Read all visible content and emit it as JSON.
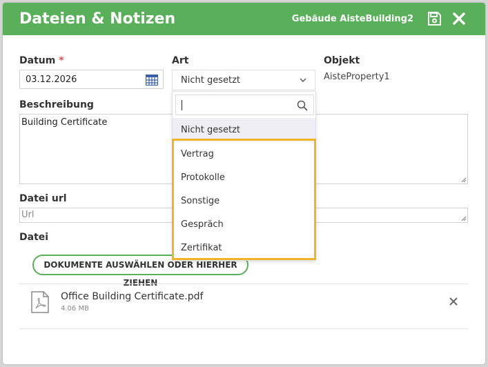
{
  "header": {
    "title": "Dateien & Notizen",
    "building": "Gebäude AisteBuilding2",
    "save_icon": "save-icon",
    "close_icon": "close-icon",
    "color": "#5aaf5a"
  },
  "form": {
    "datum": {
      "label": "Datum",
      "required_mark": "*",
      "value": "03.12.2026",
      "icon": "calendar-icon"
    },
    "art": {
      "label": "Art",
      "value": "Nicht gesetzt",
      "icon": "chevron-down-icon"
    },
    "objekt": {
      "label": "Objekt",
      "value": "AisteProperty1"
    },
    "beschreibung": {
      "label": "Beschreibung",
      "value": "Building Certificate"
    },
    "datei_url": {
      "label": "Datei url",
      "placeholder": "Url"
    },
    "datei": {
      "label": "Datei",
      "upload_label": "DOKUMENTE AUSWÄHLEN ODER HIERHER ZIEHEN"
    }
  },
  "file": {
    "name": "Office Building Certificate.pdf",
    "size": "4.06 MB",
    "icon": "pdf-file-icon",
    "remove_icon": "remove-icon"
  },
  "dropdown": {
    "search_value": "",
    "search_icon": "search-icon",
    "options": [
      "Nicht gesetzt",
      "Vertrag",
      "Protokolle",
      "Sonstige",
      "Gespräch",
      "Zertifikat"
    ],
    "selected_index": 0,
    "highlight_color": "#f0b429"
  }
}
